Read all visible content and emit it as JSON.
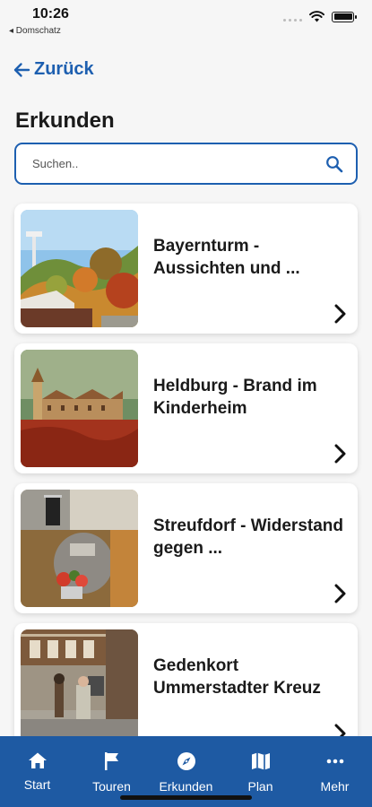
{
  "status_bar": {
    "time": "10:26",
    "back_app": "◂ Domschatz"
  },
  "nav": {
    "back_label": "Zurück"
  },
  "page": {
    "title": "Erkunden"
  },
  "search": {
    "placeholder": "Suchen.."
  },
  "items": [
    {
      "title": "Bayernturm - Aussichten und ..."
    },
    {
      "title": "Heldburg - Brand im Kinderheim"
    },
    {
      "title": "Streufdorf - Widerstand gegen ..."
    },
    {
      "title": "Gedenkort Ummerstadter Kreuz"
    }
  ],
  "tabs": [
    {
      "label": "Start",
      "icon": "home-icon"
    },
    {
      "label": "Touren",
      "icon": "flag-icon"
    },
    {
      "label": "Erkunden",
      "icon": "compass-icon"
    },
    {
      "label": "Plan",
      "icon": "map-icon"
    },
    {
      "label": "Mehr",
      "icon": "more-icon"
    }
  ],
  "colors": {
    "accent": "#1d5fb0",
    "tabbar": "#1e5aa3"
  }
}
